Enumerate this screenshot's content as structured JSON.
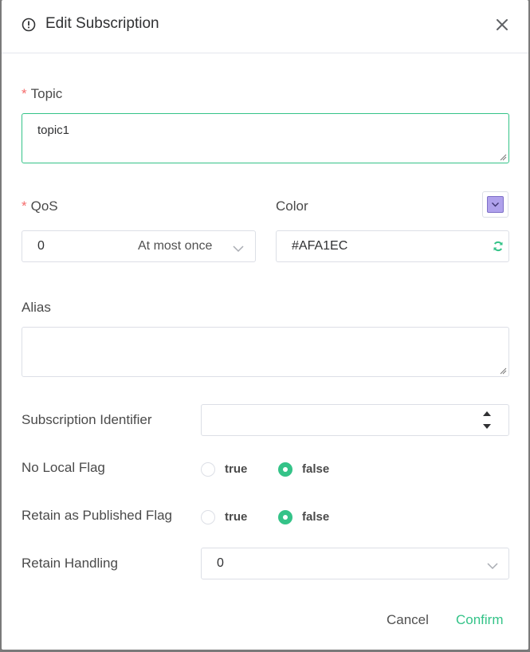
{
  "dialog": {
    "title": "Edit Subscription",
    "icons": {
      "header": "info-circle-icon",
      "close": "close-icon"
    }
  },
  "form": {
    "topic": {
      "label": "Topic",
      "required_mark": "*",
      "value": "topic1"
    },
    "qos": {
      "label": "QoS",
      "required_mark": "*",
      "value": "0",
      "description": "At most once"
    },
    "color": {
      "label": "Color",
      "value": "#AFA1EC",
      "swatch": "#AFA1EC",
      "refresh_icon": "refresh-icon"
    },
    "alias": {
      "label": "Alias",
      "value": ""
    },
    "subscription_identifier": {
      "label": "Subscription Identifier",
      "value": ""
    },
    "no_local_flag": {
      "label": "No Local Flag",
      "options": [
        "true",
        "false"
      ],
      "selected": "false"
    },
    "retain_as_published_flag": {
      "label": "Retain as Published Flag",
      "options": [
        "true",
        "false"
      ],
      "selected": "false"
    },
    "retain_handling": {
      "label": "Retain Handling",
      "value": "0"
    }
  },
  "footer": {
    "cancel_label": "Cancel",
    "confirm_label": "Confirm"
  },
  "colors": {
    "accent": "#34C388",
    "required": "#F56C6C",
    "border": "#DCDFE6"
  }
}
